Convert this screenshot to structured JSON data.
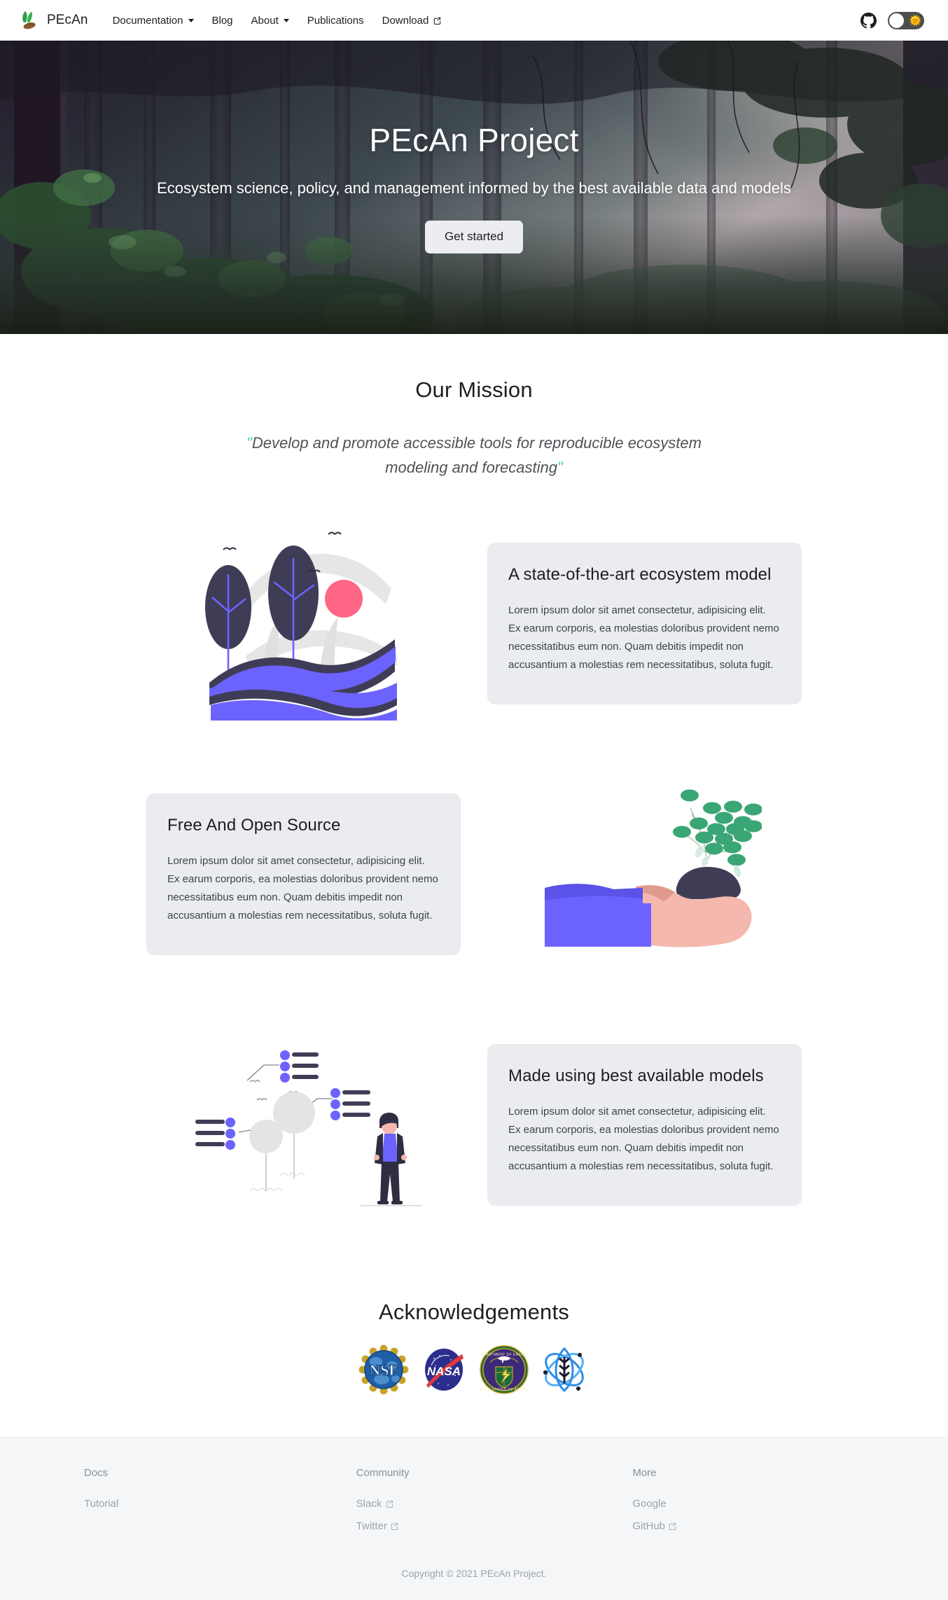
{
  "navbar": {
    "brand": {
      "name": "PEcAn",
      "logo_icon": "pecan-leaf-logo"
    },
    "items": [
      {
        "label": "Documentation",
        "has_dropdown": true,
        "external": false
      },
      {
        "label": "Blog",
        "has_dropdown": false,
        "external": false
      },
      {
        "label": "About",
        "has_dropdown": true,
        "external": false
      },
      {
        "label": "Publications",
        "has_dropdown": false,
        "external": false
      },
      {
        "label": "Download",
        "has_dropdown": false,
        "external": true
      }
    ],
    "github_icon": "github-icon",
    "theme_toggle": {
      "icon": "sun-icon",
      "state": "light"
    }
  },
  "hero": {
    "title": "PEcAn Project",
    "subtitle": "Ecosystem science, policy, and management informed by the best available data and models",
    "button_label": "Get started",
    "background_alt": "misty-forest-photo"
  },
  "mission": {
    "title": "Our Mission",
    "quote_open": "\"",
    "quote": "Develop and promote accessible tools for reproducible ecosystem modeling and forecasting",
    "quote_close": "\""
  },
  "features": [
    {
      "illustration": "forest-trees-illustration",
      "title": "A state-of-the-art ecosystem model",
      "body": "Lorem ipsum dolor sit amet consectetur, adipisicing elit. Ex earum corporis, ea molestias doloribus provident nemo necessitatibus eum non. Quam debitis impedit non accusantium a molestias rem necessitatibus, soluta fugit.",
      "media_side": "left"
    },
    {
      "illustration": "hand-holding-plant-illustration",
      "title": "Free And Open Source",
      "body": "Lorem ipsum dolor sit amet consectetur, adipisicing elit. Ex earum corporis, ea molestias doloribus provident nemo necessitatibus eum non. Quam debitis impedit non accusantium a molestias rem necessitatibus, soluta fugit.",
      "media_side": "right"
    },
    {
      "illustration": "data-trees-person-illustration",
      "title": "Made using best available models",
      "body": "Lorem ipsum dolor sit amet consectetur, adipisicing elit. Ex earum corporis, ea molestias doloribus provident nemo necessitatibus eum non. Quam debitis impedit non accusantium a molestias rem necessitatibus, soluta fugit.",
      "media_side": "left"
    }
  ],
  "acknowledgements": {
    "title": "Acknowledgements",
    "logos": [
      {
        "name": "NSF",
        "icon": "nsf-logo"
      },
      {
        "name": "NASA",
        "icon": "nasa-logo"
      },
      {
        "name": "DOE",
        "icon": "doe-logo"
      },
      {
        "name": "NEON",
        "icon": "neon-logo"
      }
    ]
  },
  "footer": {
    "columns": [
      {
        "heading": "Docs",
        "links": [
          {
            "label": "Tutorial",
            "external": false
          }
        ]
      },
      {
        "heading": "Community",
        "links": [
          {
            "label": "Slack",
            "external": true
          },
          {
            "label": "Twitter",
            "external": true
          }
        ]
      },
      {
        "heading": "More",
        "links": [
          {
            "label": "Google",
            "external": false
          },
          {
            "label": "GitHub",
            "external": true
          }
        ]
      }
    ],
    "copyright": "Copyright © 2021 PEcAn Project."
  },
  "colors": {
    "card_bg": "#eaecf0",
    "footer_bg": "#f5f6f7",
    "accent_green": "#3ecfb2",
    "illustration_purple": "#6c63ff",
    "illustration_dark": "#3f3d56",
    "illustration_pink": "#ff6584",
    "text_primary": "#1c1e21"
  }
}
